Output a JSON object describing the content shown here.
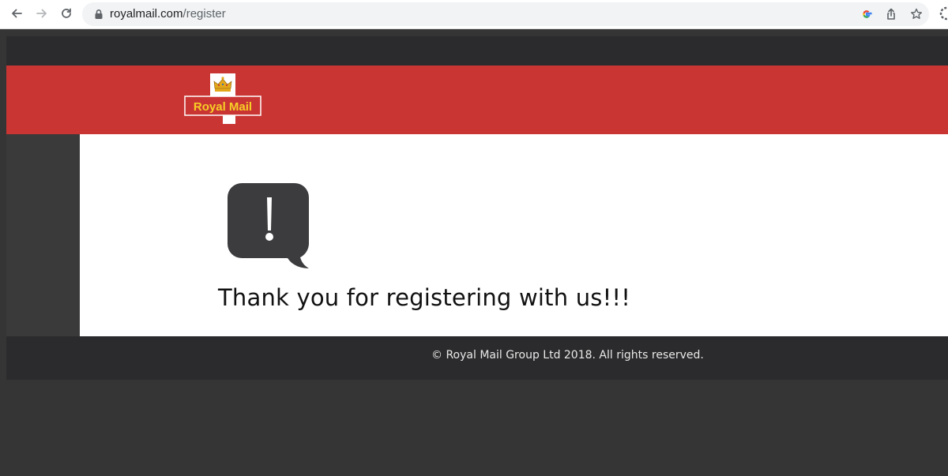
{
  "browser": {
    "url_host": "royalmail.com",
    "url_path": "/register",
    "icons": {
      "back": "arrow-left-icon",
      "forward": "arrow-right-icon",
      "reload": "reload-icon",
      "lock": "lock-icon",
      "google": "google-icon",
      "share": "share-icon",
      "bookmark": "star-icon",
      "extension": "extension-icon"
    }
  },
  "header": {
    "logo_text": "Royal Mail",
    "brand_color": "#c93533",
    "logo_text_color": "#f7cf26"
  },
  "main": {
    "alert_icon": "alert-speech-bubble-icon",
    "message": "Thank you for registering with us!!!"
  },
  "footer": {
    "copyright": "© Royal Mail Group Ltd 2018. All rights reserved."
  }
}
